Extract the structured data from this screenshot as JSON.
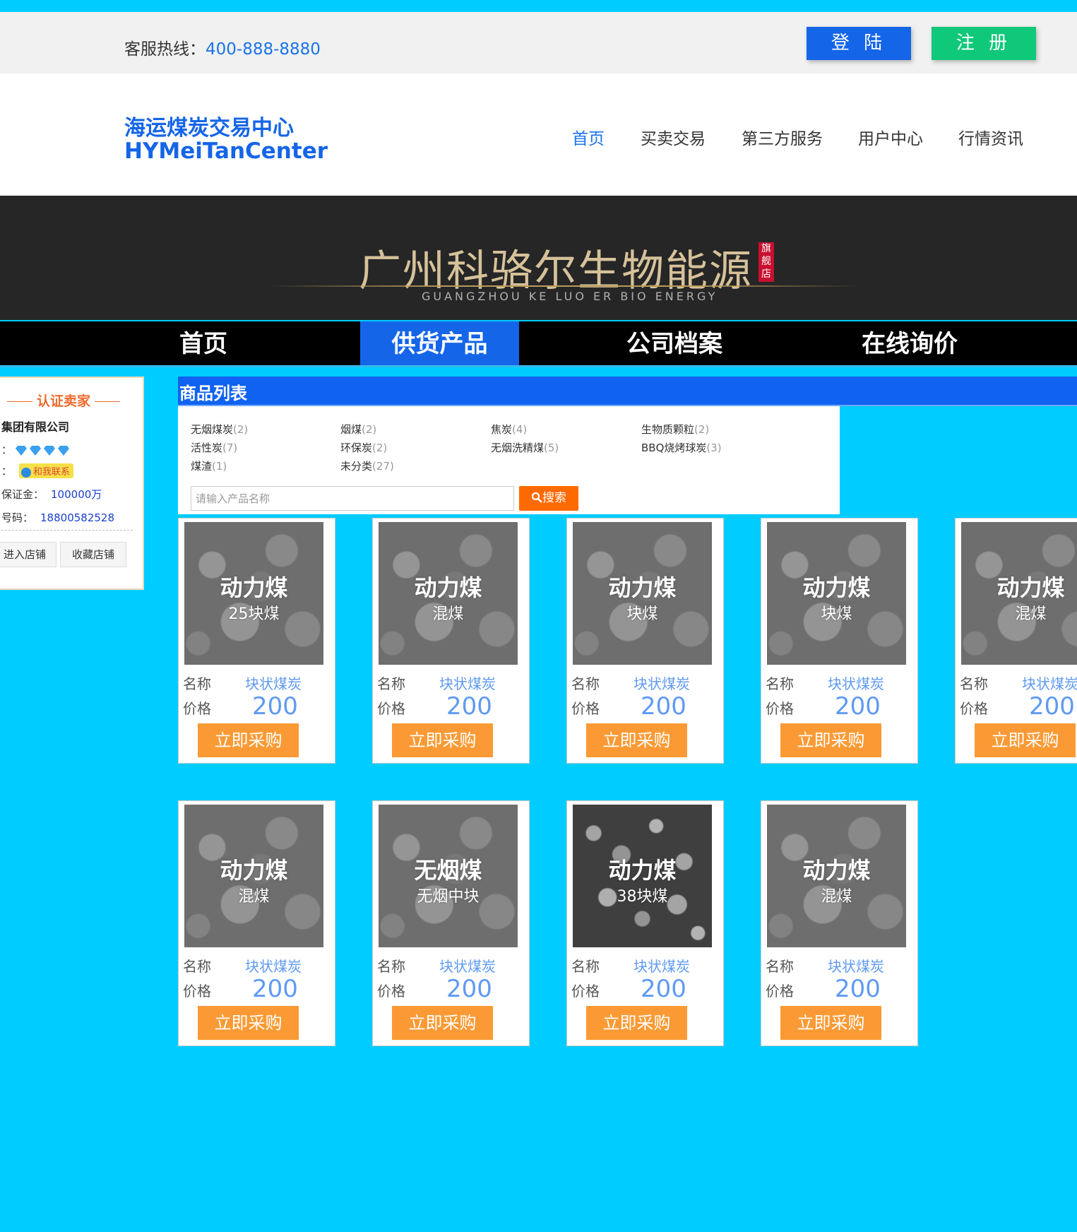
{
  "topbar": {
    "hotline_label": "客服热线：",
    "hotline_number": "400-888-8880",
    "login": "登 陆",
    "register": "注 册"
  },
  "header": {
    "logo_cn": "海运煤炭交易中心",
    "logo_en": "HYMeiTanCenter",
    "nav": [
      "首页",
      "买卖交易",
      "第三方服务",
      "用户中心",
      "行情资讯"
    ]
  },
  "banner": {
    "title": "广州科骆尔生物能源",
    "badge": "旗舰店",
    "subtitle": "GUANGZHOU KE LUO ER BIO ENERGY"
  },
  "shopnav": [
    "首页",
    "供货产品",
    "公司档案",
    "在线询价"
  ],
  "seller": {
    "title": "认证卖家",
    "company": "集团有限公司",
    "level_prefix": "：",
    "contact_prefix": "：",
    "contact_label": "和我联系",
    "deposit_label": "保证金：",
    "deposit_value": "100000万",
    "phone_label": "号码：",
    "phone_value": "18800582528",
    "enter_shop": "进入店铺",
    "fav_shop": "收藏店铺"
  },
  "product_list": {
    "title": "商品列表",
    "categories": [
      {
        "name": "无烟煤炭",
        "count": "(2)"
      },
      {
        "name": "烟煤",
        "count": "(2)"
      },
      {
        "name": "焦炭",
        "count": "(4)"
      },
      {
        "name": "生物质颗粒",
        "count": "(2)"
      },
      {
        "name": "活性炭",
        "count": "(7)"
      },
      {
        "name": "环保炭",
        "count": "(2)"
      },
      {
        "name": "无烟洗精煤",
        "count": "(5)"
      },
      {
        "name": "BBQ烧烤球炭",
        "count": "(3)"
      },
      {
        "name": "煤渣",
        "count": "(1)"
      },
      {
        "name": "未分类",
        "count": "(27)"
      }
    ],
    "search_placeholder": "请输入产品名称",
    "search_button": "搜索",
    "name_label": "名称",
    "price_label": "价格",
    "buy_label": "立即采购",
    "products": [
      {
        "img_title": "动力煤",
        "img_sub": "25块煤",
        "name": "块状煤炭",
        "price": "200"
      },
      {
        "img_title": "动力煤",
        "img_sub": "混煤",
        "name": "块状煤炭",
        "price": "200"
      },
      {
        "img_title": "动力煤",
        "img_sub": "块煤",
        "name": "块状煤炭",
        "price": "200"
      },
      {
        "img_title": "动力煤",
        "img_sub": "块煤",
        "name": "块状煤炭",
        "price": "200"
      },
      {
        "img_title": "动力煤",
        "img_sub": "混煤",
        "name": "块状煤炭",
        "price": "200"
      },
      {
        "img_title": "动力煤",
        "img_sub": "混煤",
        "name": "块状煤炭",
        "price": "200"
      },
      {
        "img_title": "无烟煤",
        "img_sub": "无烟中块",
        "name": "块状煤炭",
        "price": "200"
      },
      {
        "img_title": "动力煤",
        "img_sub": "38块煤",
        "name": "块状煤炭",
        "price": "200"
      },
      {
        "img_title": "动力煤",
        "img_sub": "混煤",
        "name": "块状煤炭",
        "price": "200"
      }
    ]
  }
}
